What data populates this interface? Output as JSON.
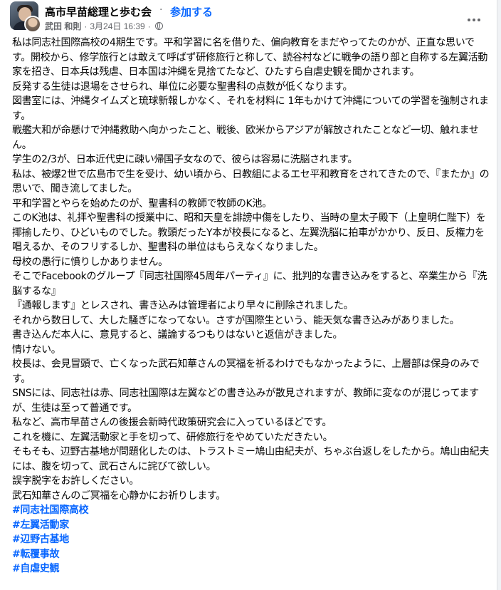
{
  "header": {
    "group_name": "高市早苗総理と歩む会",
    "separator": "·",
    "join_label": "参加する",
    "author": "武田 和則",
    "meta_separator": "·",
    "date": "3月24日 16:39",
    "meta_separator2": "·",
    "privacy_icon": "globe-icon",
    "more_icon": "more-options-icon"
  },
  "post": {
    "lines": [
      "私は同志社国際高校の4期生です。平和学習に名を借りた、偏向教育をまだやってたのかが、正直な思いです。開校から、修学旅行とは敢えて呼ばず研修旅行と称して、読谷村などに戦争の語り部と自称する左翼活動家を招き、日本兵は残虐、日本国は沖縄を見捨てたなど、ひたすら自虐史観を聞かされます。",
      "反発する生徒は退場をさせられ、単位に必要な聖書科の点数が低くなります。",
      "図書室には、沖縄タイムズと琉球新報しかなく、それを材料に 1年もかけて沖縄についての学習を強制されます。",
      "戦艦大和が命懸けで沖縄救助へ向かったこと、戦後、欧米からアジアが解放されたことなど一切、触れません。",
      "学生の2/3が、日本近代史に疎い帰国子女なので、彼らは容易に洗脳されます。",
      "私は、被爆2世で広島市で生を受け、幼い頃から、日教組によるエセ平和教育をされてきたので、『またか』の思いで、聞き流してました。",
      "平和学習とやらを始めたのが、聖書科の教師で牧師のK池。",
      "このK池は、礼拝や聖書科の授業中に、昭和天皇を誹謗中傷をしたり、当時の皇太子殿下（上皇明仁陛下）を揶揄したり、ひどいものでした。教頭だったY本が校長になると、左翼洗脳に拍車がかかり、反日、反権力を唱えるか、そのフリするしか、聖書科の単位はもらえなくなりました。",
      "母校の愚行に憤りしかありません。",
      "そこでFacebookのグループ『同志社国際45周年パーティ』に、批判的な書き込みをすると、卒業生から『洗脳するな』",
      "『通報します』とレスされ、書き込みは管理者により早々に削除されました。",
      "それから数日して、大した騒ぎになってない。さすが国際生という、能天気な書き込みがありました。",
      "書き込んだ本人に、意見すると、議論するつもりはないと返信がきました。",
      "情けない。",
      "校長は、会見冒頭で、亡くなった武石知華さんの冥福を祈るわけでもなかったように、上層部は保身のみです。",
      "SNSには、同志社は赤、同志社国際は左翼などの書き込みが散見されますが、教師に変なのが混じってますが、生徒は至って普通です。",
      "私など、高市早苗さんの後援会新時代政策研究会に入っているほどです。",
      "これを機に、左翼活動家と手を切って、研修旅行をやめていただきたい。",
      "そもそも、辺野古基地が問題化したのは、トラストミー鳩山由紀夫が、ちゃぶ台返しをしたから。鳩山由紀夫には、腹を切って、武石さんに詫びて欲しい。",
      "誤字脱字をお許しください。",
      "武石知華さんのご冥福を心静かにお祈りします。"
    ],
    "hashtags": [
      "#同志社国際高校",
      "#左翼活動家",
      "#辺野古基地",
      "#転覆事故",
      "#自虐史観"
    ]
  },
  "colors": {
    "link": "#0866ff",
    "text": "#050505",
    "secondary": "#65676b"
  }
}
